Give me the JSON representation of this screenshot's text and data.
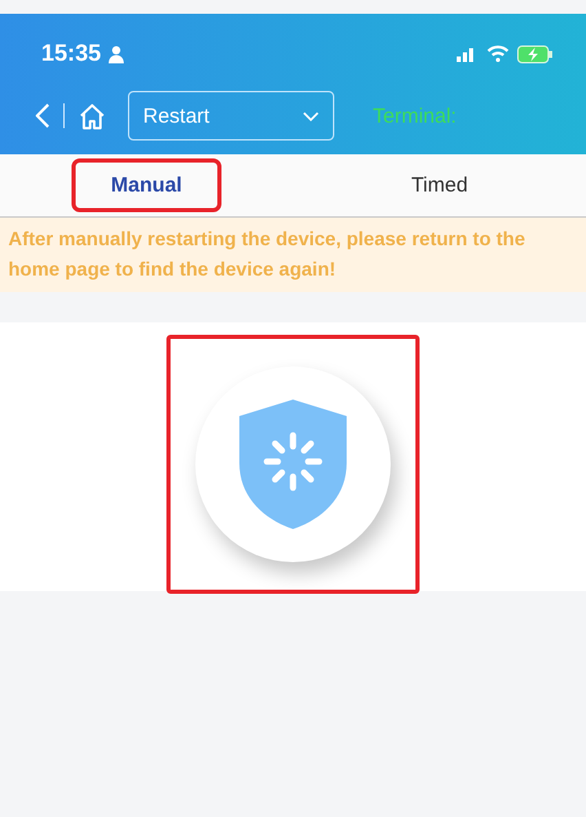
{
  "status_bar": {
    "time": "15:35"
  },
  "header": {
    "dropdown": {
      "value": "Restart"
    },
    "terminal_label": "Terminal:"
  },
  "tabs": [
    {
      "label": "Manual",
      "selected": true,
      "highlighted": true
    },
    {
      "label": "Timed",
      "selected": false,
      "highlighted": false
    }
  ],
  "notice": "After manually restarting the device, please return to the home page to find the device again!",
  "restart_button": {
    "highlighted": true
  }
}
